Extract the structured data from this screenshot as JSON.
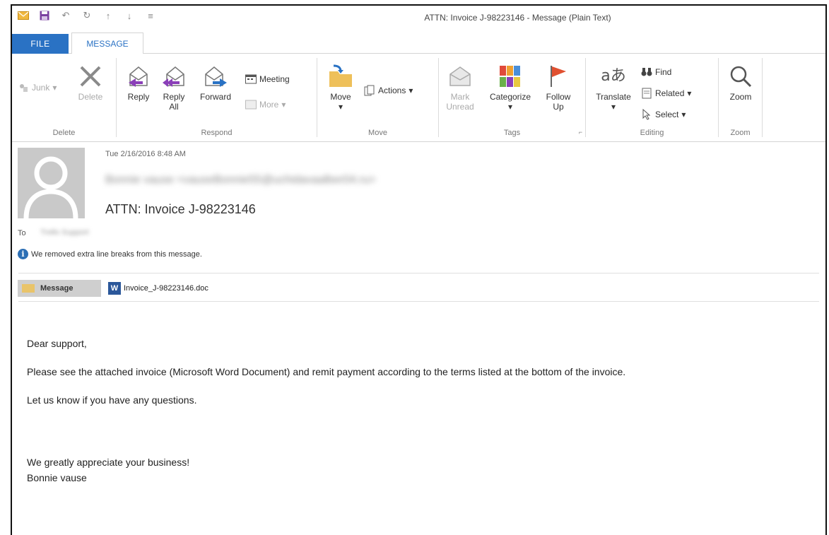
{
  "window": {
    "title": "ATTN: Invoice J-98223146 - Message (Plain Text)"
  },
  "tabs": [
    {
      "label": "FILE"
    },
    {
      "label": "MESSAGE"
    }
  ],
  "ribbon": {
    "delete_group": {
      "label": "Delete",
      "junk": "Junk",
      "delete": "Delete"
    },
    "respond_group": {
      "label": "Respond",
      "reply": "Reply",
      "reply_all_1": "Reply",
      "reply_all_2": "All",
      "forward": "Forward",
      "meeting": "Meeting",
      "more": "More"
    },
    "move_group": {
      "label": "Move",
      "move": "Move",
      "actions": "Actions"
    },
    "tags_group": {
      "label": "Tags",
      "mark_unread_1": "Mark",
      "mark_unread_2": "Unread",
      "categorize": "Categorize",
      "follow_up_1": "Follow",
      "follow_up_2": "Up"
    },
    "editing_group": {
      "label": "Editing",
      "translate": "Translate",
      "find": "Find",
      "related": "Related",
      "select": "Select"
    },
    "zoom_group": {
      "label": "Zoom",
      "zoom": "Zoom"
    }
  },
  "message": {
    "date": "Tue 2/16/2016 8:48 AM",
    "sender": "Bonnie vause <vauseBonnie55@uchidavaalber04.ru>",
    "subject": "ATTN: Invoice J-98223146",
    "to_label": "To",
    "to_value": "Trello Support",
    "info": "We removed extra line breaks from this message.",
    "message_tab": "Message",
    "attachment": "Invoice_J-98223146.doc",
    "body": [
      "Dear support,",
      "Please see the attached invoice (Microsoft Word Document) and remit payment according to the terms listed at the bottom of the invoice.",
      "Let us know if you have any questions.",
      "We greatly appreciate your business!",
      "Bonnie vause"
    ]
  },
  "colors": {
    "accent": "#2a72c4",
    "avatar_bg": "#c9c9c9"
  }
}
